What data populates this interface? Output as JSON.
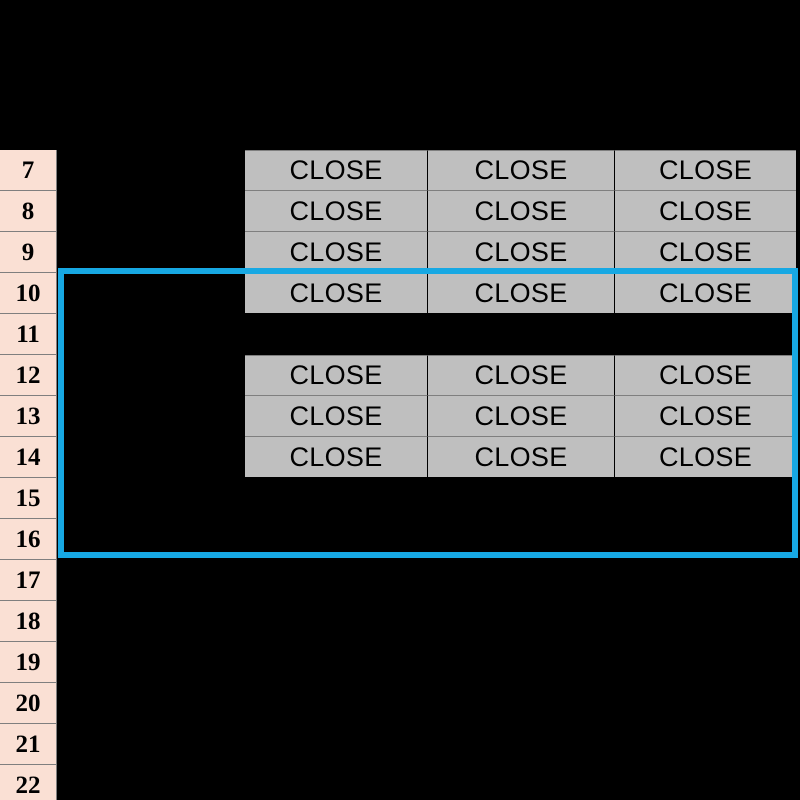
{
  "spreadsheet": {
    "row_headers": [
      "7",
      "8",
      "9",
      "10",
      "11",
      "12",
      "13",
      "14",
      "15",
      "16",
      "17",
      "18",
      "19",
      "20",
      "21",
      "22"
    ],
    "rows": [
      {
        "header": "7",
        "cells": [
          "CLOSE",
          "CLOSE",
          "CLOSE"
        ]
      },
      {
        "header": "8",
        "cells": [
          "CLOSE",
          "CLOSE",
          "CLOSE"
        ]
      },
      {
        "header": "9",
        "cells": [
          "CLOSE",
          "CLOSE",
          "CLOSE"
        ]
      },
      {
        "header": "10",
        "cells": [
          "CLOSE",
          "CLOSE",
          "CLOSE"
        ]
      },
      {
        "header": "11",
        "cells": []
      },
      {
        "header": "12",
        "cells": [
          "CLOSE",
          "CLOSE",
          "CLOSE"
        ]
      },
      {
        "header": "13",
        "cells": [
          "CLOSE",
          "CLOSE",
          "CLOSE"
        ]
      },
      {
        "header": "14",
        "cells": [
          "CLOSE",
          "CLOSE",
          "CLOSE"
        ]
      },
      {
        "header": "15",
        "cells": []
      },
      {
        "header": "16",
        "cells": []
      },
      {
        "header": "17",
        "cells": []
      },
      {
        "header": "18",
        "cells": []
      },
      {
        "header": "19",
        "cells": []
      },
      {
        "header": "20",
        "cells": []
      },
      {
        "header": "21",
        "cells": []
      },
      {
        "header": "22",
        "cells": []
      }
    ]
  },
  "selection": {
    "label": "selection-rectangle",
    "color": "#17A8E3"
  },
  "colors": {
    "background": "#000000",
    "row_header_fill": "#FAE0D4",
    "cell_fill": "#BFBFBF",
    "cell_text": "#000000",
    "gridline": "#7F7F7F",
    "accent": "#17A8E3"
  }
}
